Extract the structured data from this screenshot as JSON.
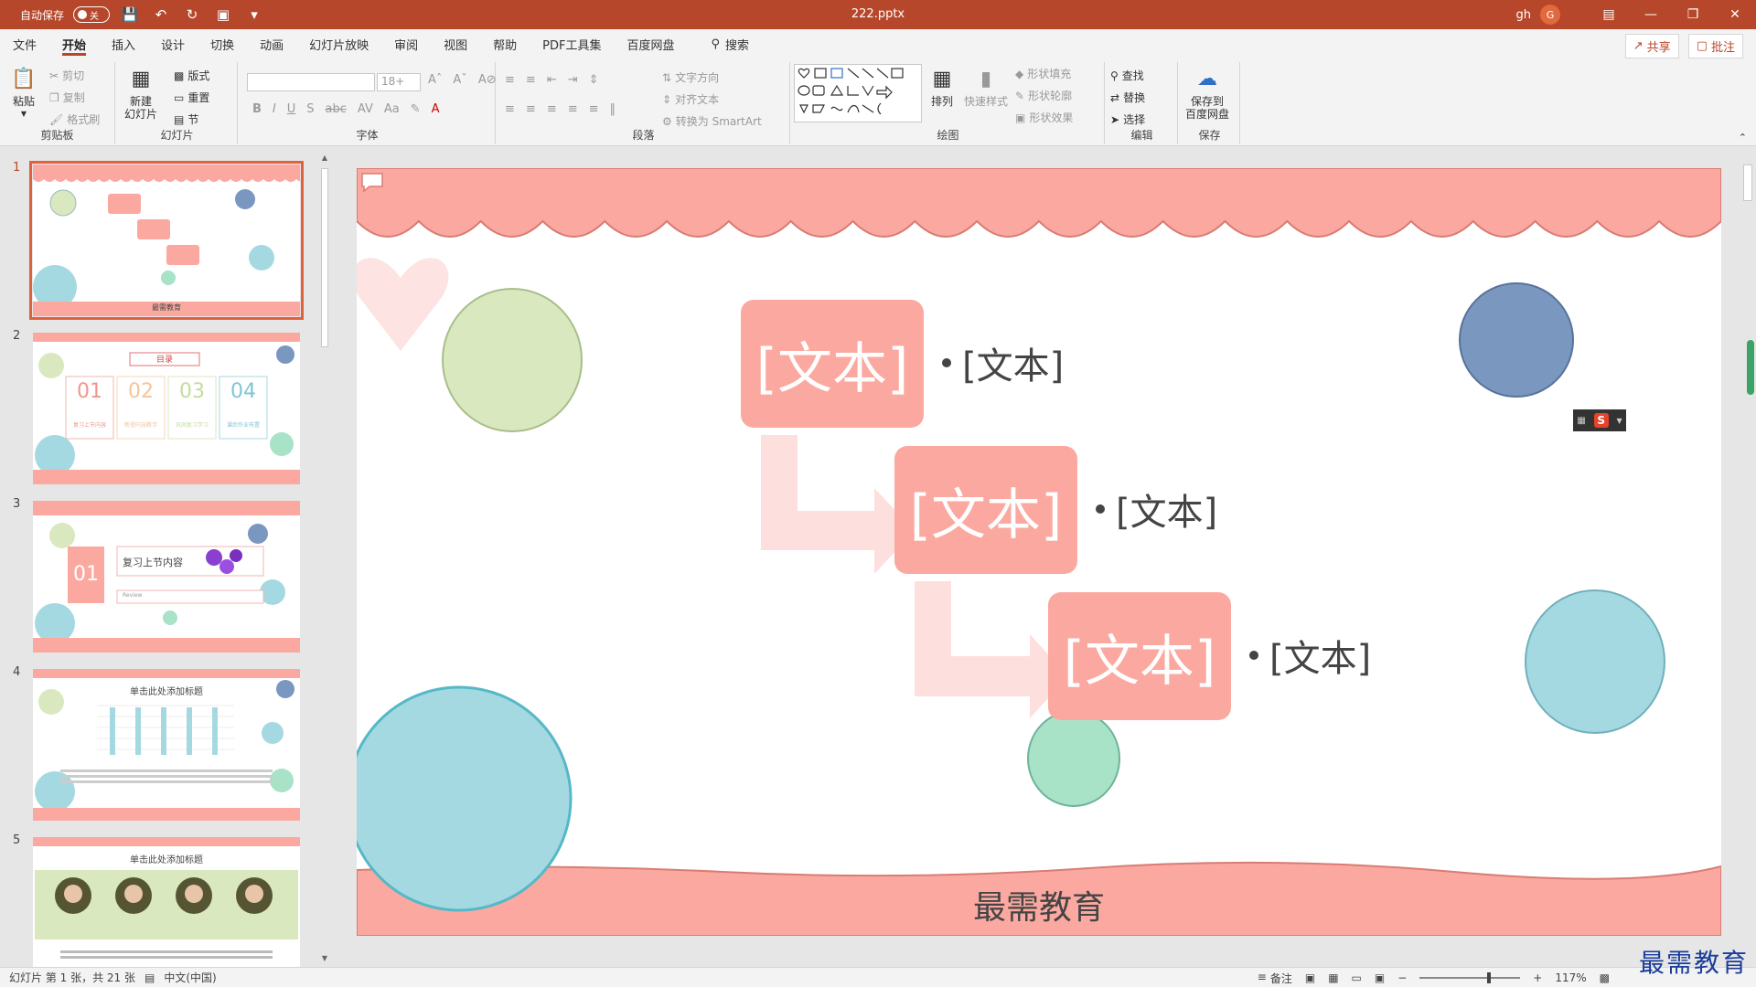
{
  "titlebar": {
    "autosave_label": "自动保存",
    "autosave_state": "关",
    "filename": "222.pptx",
    "user": "gh",
    "avatar_letter": "G"
  },
  "menu": {
    "tabs": [
      "文件",
      "开始",
      "插入",
      "设计",
      "切换",
      "动画",
      "幻灯片放映",
      "审阅",
      "视图",
      "帮助",
      "PDF工具集",
      "百度网盘"
    ],
    "active": "开始",
    "search": "搜索",
    "share": "共享",
    "comment": "批注"
  },
  "ribbon": {
    "clipboard": {
      "label": "剪贴板",
      "paste": "粘贴",
      "cut": "剪切",
      "copy": "复制",
      "format_painter": "格式刷"
    },
    "slides": {
      "label": "幻灯片",
      "new_slide": "新建\n幻灯片",
      "layout": "版式",
      "reset": "重置",
      "section": "节"
    },
    "font": {
      "label": "字体",
      "size": "18+"
    },
    "paragraph": {
      "label": "段落",
      "text_direction": "文字方向",
      "align_text": "对齐文本",
      "smartart": "转换为 SmartArt"
    },
    "drawing": {
      "label": "绘图",
      "arrange": "排列",
      "quick_styles": "快速样式",
      "shape_fill": "形状填充",
      "shape_outline": "形状轮廓",
      "shape_effects": "形状效果"
    },
    "editing": {
      "label": "编辑",
      "find": "查找",
      "replace": "替换",
      "select": "选择"
    },
    "save": {
      "label": "保存",
      "save_baidu": "保存到\n百度网盘"
    }
  },
  "thumbnails": [
    {
      "num": "1",
      "footer": "最需教育"
    },
    {
      "num": "2",
      "title": "目录",
      "items": [
        "01",
        "02",
        "03",
        "04"
      ],
      "captions": [
        "复习上节内容",
        "新授内容教学",
        "巩固复习学习",
        "课后作业布置"
      ]
    },
    {
      "num": "3",
      "badge": "01",
      "heading": "复习上节内容",
      "sub": "Review"
    },
    {
      "num": "4",
      "title": "单击此处添加标题"
    },
    {
      "num": "5",
      "title": "单击此处添加标题"
    }
  ],
  "slide": {
    "box1": "[文本]",
    "box2": "[文本]",
    "box3": "[文本]",
    "bullet1": "[文本]",
    "bullet2": "[文本]",
    "bullet3": "[文本]",
    "footer": "最需教育"
  },
  "status": {
    "slide_info": "幻灯片 第 1 张，共 21 张",
    "language": "中文(中国)",
    "notes": "备注",
    "zoom": "117%"
  },
  "watermark": "最需教育",
  "colors": {
    "accent": "#b7472a",
    "pink": "#fba9a0",
    "green": "#d9e8bf",
    "blue": "#7a97bf",
    "cyan": "#a5d9e2",
    "mint": "#a8e3c8"
  }
}
